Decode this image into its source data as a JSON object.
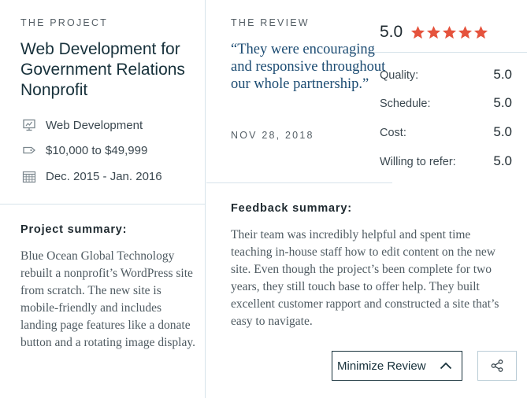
{
  "project": {
    "section_label": "THE PROJECT",
    "title": "Web Development for Government Relations Nonprofit",
    "meta": [
      {
        "icon": "presentation-screen-icon",
        "text": "Web Development"
      },
      {
        "icon": "price-tag-icon",
        "text": "$10,000 to $49,999"
      },
      {
        "icon": "calendar-icon",
        "text": "Dec. 2015 - Jan. 2016"
      }
    ],
    "summary_heading": "Project summary:",
    "summary_text": "Blue Ocean Global Technology rebuilt a nonprofit’s WordPress site from scratch. The new site is mobile-friendly and includes landing page features like a donate button and a rotating image display."
  },
  "review": {
    "section_label": "THE REVIEW",
    "quote": "“They were encouraging and responsive throughout our whole partnership.”",
    "date": "NOV 28, 2018",
    "feedback_heading": "Feedback summary:",
    "feedback_text": "Their team was incredibly helpful and spent time teaching in-house staff how to edit content on the new site. Even though the project’s been complete for two years, they still touch base to offer help. They built excellent customer rapport and constructed a site that’s easy to navigate."
  },
  "ratings": {
    "overall": "5.0",
    "stars": 5,
    "star_color": "#e5533d",
    "rows": [
      {
        "label": "Quality:",
        "value": "5.0"
      },
      {
        "label": "Schedule:",
        "value": "5.0"
      },
      {
        "label": "Cost:",
        "value": "5.0"
      },
      {
        "label": "Willing to refer:",
        "value": "5.0"
      }
    ]
  },
  "actions": {
    "minimize_label": "Minimize Review",
    "minimize_icon": "chevron-up-icon",
    "share_icon": "share-icon"
  },
  "colors": {
    "accent": "#17313b",
    "quote": "#1b4b72",
    "divider": "#d7e3ea"
  }
}
